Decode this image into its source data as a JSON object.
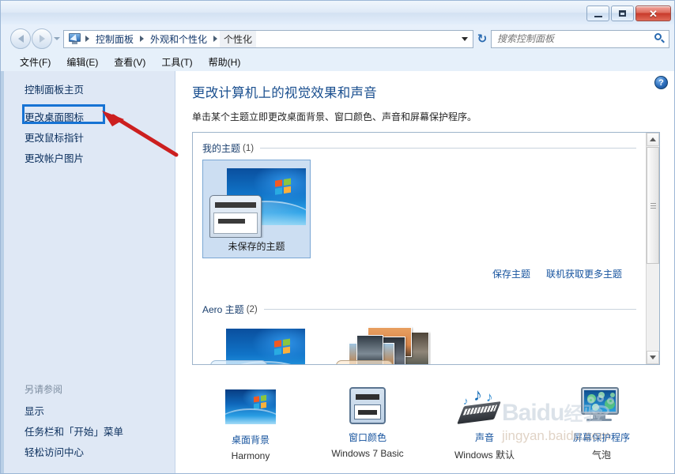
{
  "window": {
    "controls": {
      "minimize": "—",
      "maximize": "□",
      "close": "✕"
    }
  },
  "nav": {
    "back_icon": "back-arrow-icon",
    "forward_icon": "forward-arrow-icon",
    "history_caret": "chevron-down-icon",
    "cp_icon": "control-panel-icon",
    "breadcrumbs": [
      "控制面板",
      "外观和个性化",
      "个性化"
    ],
    "address_caret": "chevron-down-icon",
    "refresh_glyph": "↻"
  },
  "search": {
    "placeholder": "搜索控制面板",
    "value": "",
    "icon": "search-icon"
  },
  "menu": {
    "items": [
      "文件(F)",
      "编辑(E)",
      "查看(V)",
      "工具(T)",
      "帮助(H)"
    ]
  },
  "sidebar": {
    "home": "控制面板主页",
    "links": [
      "更改桌面图标",
      "更改鼠标指针",
      "更改帐户图片"
    ],
    "see_also_title": "另请参阅",
    "see_also": [
      "显示",
      "任务栏和「开始」菜单",
      "轻松访问中心"
    ],
    "highlight_target": "更改桌面图标",
    "highlight_color": "#1673d4",
    "arrow_color": "#cc1f1f"
  },
  "content": {
    "help_label": "?",
    "heading": "更改计算机上的视觉效果和声音",
    "subtitle": "单击某个主题立即更改桌面背景、窗口颜色、声音和屏幕保护程序。",
    "groups": [
      {
        "title": "我的主题",
        "count": "(1)",
        "themes": [
          {
            "label": "未保存的主题",
            "selected": true,
            "thumb": "windows-desktop-dialog-thumb"
          }
        ]
      },
      {
        "title": "Aero 主题",
        "count": "(2)",
        "themes": [
          {
            "label": "",
            "selected": false,
            "thumb": "windows-aero-thumb"
          },
          {
            "label": "",
            "selected": false,
            "thumb": "photo-stack-thumb"
          }
        ]
      }
    ],
    "links": [
      "保存主题",
      "联机获取更多主题"
    ],
    "scrollbar": {
      "up": "triangle-up-icon",
      "down": "triangle-down-icon",
      "thumb": "scroll-thumb"
    }
  },
  "settings": [
    {
      "name": "桌面背景",
      "value": "Harmony",
      "icon": "desktop-background-icon"
    },
    {
      "name": "窗口颜色",
      "value": "Windows 7 Basic",
      "icon": "window-color-icon"
    },
    {
      "name": "声音",
      "value": "Windows 默认",
      "icon": "sound-icon"
    },
    {
      "name": "屏幕保护程序",
      "value": "气泡",
      "icon": "screensaver-icon"
    }
  ],
  "watermark": {
    "brand": "Baidu",
    "brand_cn": "经验",
    "url": "jingyan.baidu.com",
    "paw": "baidu-paw-icon"
  }
}
